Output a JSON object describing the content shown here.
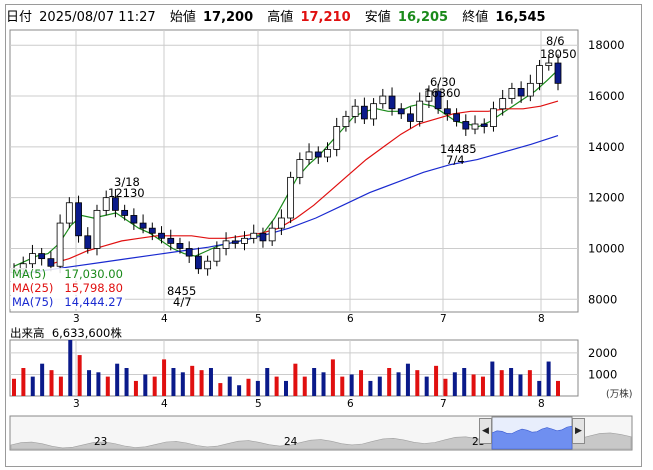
{
  "quote_header": {
    "date_label": "日付",
    "datetime": "2025/08/07 11:27",
    "open_label": "始値",
    "open_value": "17,200",
    "high_label": "高値",
    "high_value": "17,210",
    "low_label": "安値",
    "low_value": "16,205",
    "close_label": "終値",
    "close_value": "16,545"
  },
  "colors": {
    "up_candle": "#ffffff",
    "down_candle": "#0a1a8a",
    "ma5": "#1a8a1a",
    "ma25": "#e01010",
    "ma75": "#1a2ad0",
    "volume_up": "#e01010",
    "volume_down": "#0a1a8a",
    "grid": "#cccccc"
  },
  "moving_averages": [
    {
      "label": "MA(5)",
      "value": "17,030.00",
      "color": "#1a8a1a"
    },
    {
      "label": "MA(25)",
      "value": "15,798.80",
      "color": "#e01010"
    },
    {
      "label": "MA(75)",
      "value": "14,444.27",
      "color": "#1a2ad0"
    }
  ],
  "volume_label": "出来高",
  "volume_value": "6,633,600株",
  "volume_unit": "(万株)",
  "annotations": [
    {
      "date": "3/18",
      "value": "12130",
      "kind": "high"
    },
    {
      "date": "4/7",
      "value": "8455",
      "kind": "low"
    },
    {
      "date": "6/30",
      "value": "16360",
      "kind": "high"
    },
    {
      "date": "7/4",
      "value": "14485",
      "kind": "low"
    },
    {
      "date": "8/6",
      "value": "18050",
      "kind": "high"
    }
  ],
  "navigator": {
    "labels": [
      "23",
      "24",
      "25"
    ],
    "left_button_icon": "triangle-left-icon",
    "right_button_icon": "triangle-right-icon"
  },
  "chart_data": [
    {
      "type": "candlestick",
      "title": "",
      "x": [
        "3",
        "4",
        "5",
        "6",
        "7",
        "8"
      ],
      "y_ticks": [
        "8000",
        "10000",
        "12000",
        "14000",
        "16000",
        "18000"
      ],
      "ylim": [
        7500,
        18600
      ],
      "grid": true,
      "price_closes": [
        9200,
        9400,
        9800,
        9600,
        9300,
        11000,
        11800,
        10500,
        10000,
        11500,
        12000,
        11500,
        11300,
        11000,
        10800,
        10600,
        10400,
        10200,
        10000,
        9700,
        9200,
        9500,
        10000,
        10300,
        10200,
        10400,
        10600,
        10300,
        10800,
        11200,
        12800,
        13500,
        13800,
        13600,
        13900,
        14800,
        15200,
        15600,
        15100,
        15700,
        16000,
        15500,
        15300,
        15000,
        15800,
        16200,
        15500,
        15300,
        15000,
        14700,
        14900,
        14800,
        15500,
        15900,
        16300,
        16000,
        16500,
        17200,
        17300,
        16500
      ],
      "series": [
        {
          "name": "MA(5)",
          "values": [
            9300,
            9500,
            9700,
            9800,
            10200,
            10900,
            11300,
            11200,
            11300,
            11400,
            11100,
            10800,
            10600,
            10300,
            10000,
            9800,
            9700,
            9900,
            10100,
            10200,
            10300,
            10400,
            10600,
            11200,
            12000,
            12800,
            13300,
            13700,
            14200,
            14700,
            15200,
            15400,
            15500,
            15400,
            15400,
            15600,
            15700,
            15600,
            15300,
            15000,
            14900,
            14800,
            15000,
            15300,
            15600,
            15900,
            16200,
            16600,
            17030
          ]
        },
        {
          "name": "MA(25)",
          "values": [
            9400,
            9600,
            9900,
            10100,
            10300,
            10400,
            10500,
            10500,
            10500,
            10400,
            10400,
            10500,
            10600,
            10800,
            11200,
            11700,
            12300,
            12900,
            13500,
            14000,
            14500,
            14900,
            15100,
            15300,
            15400,
            15400,
            15500,
            15500,
            15600,
            15800
          ]
        },
        {
          "name": "MA(75)",
          "values": [
            9000,
            9150,
            9300,
            9450,
            9600,
            9750,
            9900,
            10050,
            10250,
            10500,
            10800,
            11200,
            11700,
            12200,
            12600,
            13000,
            13300,
            13500,
            13800,
            14100,
            14444
          ]
        }
      ]
    },
    {
      "type": "bar",
      "title": "",
      "y_ticks": [
        "1000",
        "2000"
      ],
      "ylim": [
        0,
        2600
      ],
      "x": [
        "3",
        "4",
        "5",
        "6",
        "7",
        "8"
      ],
      "series": [
        {
          "name": "出来高",
          "values": [
            800,
            1300,
            900,
            1500,
            1200,
            900,
            2600,
            1900,
            1200,
            1100,
            900,
            1500,
            1300,
            700,
            1000,
            900,
            1700,
            1300,
            1100,
            1400,
            1200,
            1300,
            600,
            900,
            500,
            800,
            700,
            1300,
            900,
            700,
            1500,
            900,
            1300,
            1100,
            1700,
            900,
            1000,
            1200,
            700,
            900,
            1300,
            1100,
            1500,
            1200,
            900,
            1400,
            800,
            1100,
            1300,
            1000,
            900,
            1600,
            1200,
            1300,
            1000,
            1200,
            700,
            1600,
            700
          ]
        }
      ]
    }
  ]
}
